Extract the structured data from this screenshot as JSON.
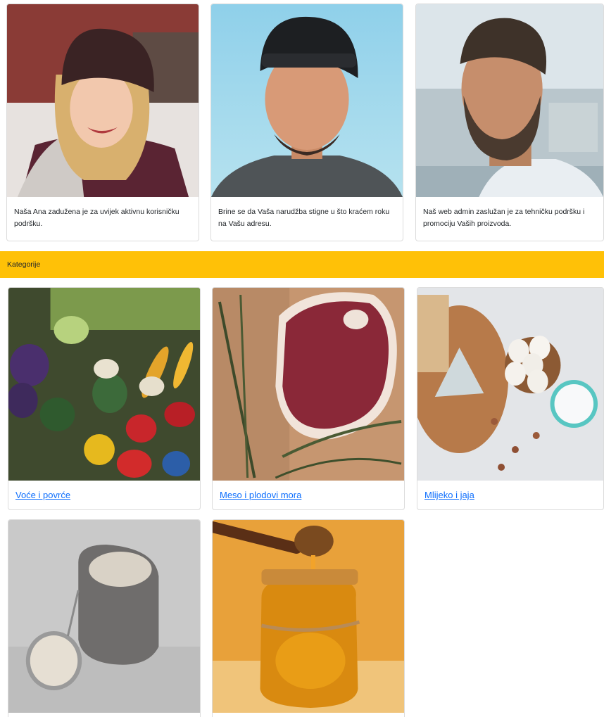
{
  "team": [
    {
      "photo_icon": "woman-beanie-photo",
      "caption": "Naša Ana zadužena je za uvijek aktivnu korisničku podršku."
    },
    {
      "photo_icon": "man-cap-photo",
      "caption": "Brine se da Vaša narudžba stigne u što kraćem roku na Vašu adresu."
    },
    {
      "photo_icon": "bearded-man-photo",
      "caption": "Naš web admin zaslužan je za tehničku podršku i promociju Vaših proizvoda."
    }
  ],
  "banner": {
    "title": "Kategorije"
  },
  "categories": [
    {
      "photo_icon": "vegetables-photo",
      "label": "Voće i povrće"
    },
    {
      "photo_icon": "meat-photo",
      "label": "Meso i plodovi mora"
    },
    {
      "photo_icon": "dairy-eggs-photo",
      "label": "Mlijeko i jaja"
    },
    {
      "photo_icon": "flour-sack-photo",
      "label": ""
    },
    {
      "photo_icon": "honey-jar-photo",
      "label": ""
    }
  ],
  "colors": {
    "banner": "#ffc107",
    "link": "#0d6efd",
    "border": "#dcdcdc"
  }
}
